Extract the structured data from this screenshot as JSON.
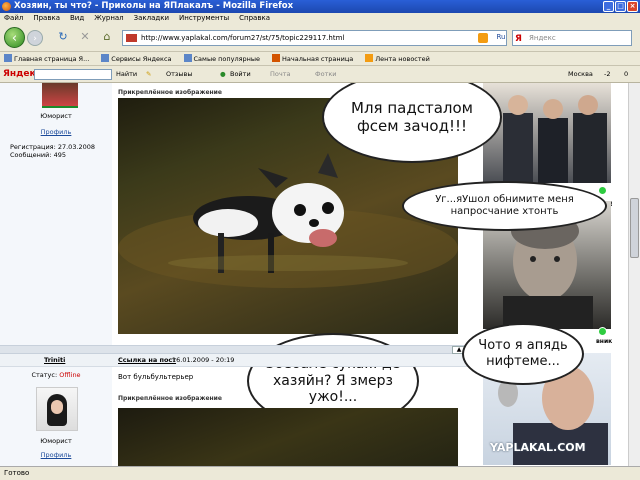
{
  "window": {
    "title": "Хозяин, ты что? - Приколы на ЯПлакалъ - Mozilla Firefox"
  },
  "menu": [
    "Файл",
    "Правка",
    "Вид",
    "Журнал",
    "Закладки",
    "Инструменты",
    "Справка"
  ],
  "nav": {
    "url": "http://www.yaplakal.com/forum27/st/75/topic229117.html",
    "search_placeholder": "Яндекс",
    "search_engine": "Ru"
  },
  "bookmarks": [
    "Главная страница Я...",
    "Сервисы Яндекса",
    "Самые популярные",
    "Начальная страница",
    "Лента новостей"
  ],
  "yandex_bar": {
    "find": "Найти",
    "reviews": "Отзывы",
    "login": "Войти",
    "mail": "Почта",
    "photos": "Фотки",
    "city": "Москва",
    "temp": "-2",
    "counter": "0"
  },
  "post1": {
    "rank": "Юморист",
    "profile": "Профиль",
    "registered": "Регистрация: 27.03.2008",
    "messages": "Сообщений: 495",
    "image_label": "Прикреплённое изображение",
    "bubble_dog": "Зоебале сука... де хазяйн? Я змерз ужо!..."
  },
  "post2": {
    "author": "Triniti",
    "status_label": "Статус:",
    "status_value": "Offline",
    "rank": "Юморист",
    "profile": "Профиль",
    "post_link": "Ссылка на пост",
    "date": "16.01.2009 - 20:19",
    "text": "Вот бульбультерьер",
    "image_label": "Прикреплённое изображение"
  },
  "bubbles": {
    "top": "Мля падсталом фсем зачод!!!",
    "middle": "Уг...яУшол обнимите меня напросчание хтонть",
    "bottom": "Чото я апядь нифтеме..."
  },
  "side_fragments": {
    "a": "ов!",
    "b": "вник"
  },
  "watermark": "YAPLAKAL.COM",
  "status_bar": "Готово"
}
